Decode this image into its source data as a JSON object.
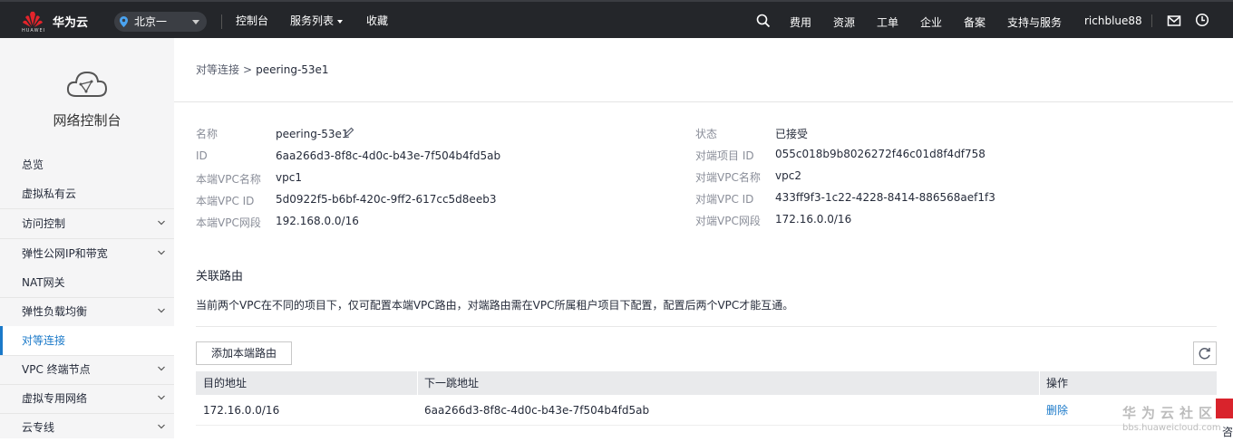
{
  "header": {
    "brand": "华为云",
    "logo_text": "HUAWEI",
    "region": "北京一",
    "nav": [
      "控制台",
      "服务列表",
      "收藏"
    ],
    "right_nav": [
      "费用",
      "资源",
      "工单",
      "企业",
      "备案",
      "支持与服务"
    ],
    "username": "richblue88",
    "icons": [
      "search-icon",
      "mail-icon",
      "clock-icon"
    ]
  },
  "sidebar": {
    "title": "网络控制台",
    "items": [
      {
        "label": "总览",
        "expandable": false
      },
      {
        "label": "虚拟私有云",
        "expandable": false
      },
      {
        "label": "访问控制",
        "expandable": true
      },
      {
        "label": "弹性公网IP和带宽",
        "expandable": true
      },
      {
        "label": "NAT网关",
        "expandable": false
      },
      {
        "label": "弹性负载均衡",
        "expandable": true
      },
      {
        "label": "对等连接",
        "expandable": false,
        "active": true
      },
      {
        "label": "VPC 终端节点",
        "expandable": true
      },
      {
        "label": "虚拟专用网络",
        "expandable": true
      },
      {
        "label": "云专线",
        "expandable": true
      }
    ]
  },
  "breadcrumb": {
    "parent": "对等连接",
    "current": "peering-53e1"
  },
  "details": {
    "left": [
      {
        "label": "名称",
        "value": "peering-53e1"
      },
      {
        "label": "ID",
        "value": "6aa266d3-8f8c-4d0c-b43e-7f504b4fd5ab"
      },
      {
        "label": "本端VPC名称",
        "value": "vpc1"
      },
      {
        "label": "本端VPC ID",
        "value": "5d0922f5-b6bf-420c-9ff2-617cc5d8eeb3"
      },
      {
        "label": "本端VPC网段",
        "value": "192.168.0.0/16"
      }
    ],
    "right": [
      {
        "label": "状态",
        "value": "已接受"
      },
      {
        "label": "对端项目 ID",
        "value": "055c018b9b8026272f46c01d8f4df758"
      },
      {
        "label": "对端VPC名称",
        "value": "vpc2"
      },
      {
        "label": "对端VPC ID",
        "value": "433ff9f3-1c22-4228-8414-886568aef1f3"
      },
      {
        "label": "对端VPC网段",
        "value": "172.16.0.0/16"
      }
    ]
  },
  "routes": {
    "title": "关联路由",
    "description": "当前两个VPC在不同的项目下，仅可配置本端VPC路由，对端路由需在VPC所属租户项目下配置，配置后两个VPC才能互通。",
    "add_button": "添加本端路由",
    "columns": [
      "目的地址",
      "下一跳地址",
      "操作"
    ],
    "rows": [
      {
        "destination": "172.16.0.0/16",
        "next_hop": "6aa266d3-8f8c-4d0c-b43e-7f504b4fd5ab",
        "action": "删除"
      }
    ]
  },
  "watermark": {
    "line1": "华为云社区",
    "line2": "bbs.huaweicloud.com"
  },
  "float_tab": "咨",
  "colors": {
    "topbar": "#24262a",
    "accent": "#1a79c9",
    "sidebar_bg": "#f5f5f6",
    "table_header": "#e9eaec"
  }
}
